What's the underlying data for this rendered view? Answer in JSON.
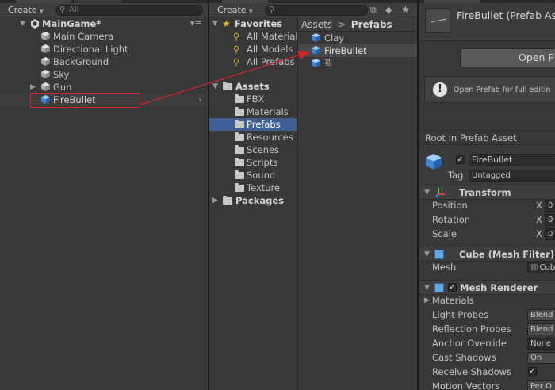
{
  "hierarchy": {
    "create_label": "Create",
    "search_placeholder": "All",
    "scene_name": "MainGame*",
    "items": [
      {
        "label": "Main Camera"
      },
      {
        "label": "Directional Light"
      },
      {
        "label": "BackGround"
      },
      {
        "label": "Sky"
      },
      {
        "label": "Gun"
      },
      {
        "label": "FireBullet"
      }
    ]
  },
  "project": {
    "create_label": "Create",
    "favorites": {
      "label": "Favorites",
      "items": [
        {
          "label": "All Material"
        },
        {
          "label": "All Models"
        },
        {
          "label": "All Prefabs"
        }
      ]
    },
    "assets": {
      "label": "Assets",
      "folders": [
        {
          "label": "FBX"
        },
        {
          "label": "Materials"
        },
        {
          "label": "Prefabs"
        },
        {
          "label": "Resources"
        },
        {
          "label": "Scenes"
        },
        {
          "label": "Scripts"
        },
        {
          "label": "Sound"
        },
        {
          "label": "Texture"
        }
      ]
    },
    "packages_label": "Packages",
    "breadcrumb": {
      "root": "Assets",
      "sep": ">",
      "current": "Prefabs"
    },
    "files": [
      {
        "label": "Clay"
      },
      {
        "label": "FireBullet"
      },
      {
        "label": "꾁"
      }
    ]
  },
  "inspector": {
    "prefab_title": "FireBullet (Prefab As",
    "open_prefab_label": "Open P",
    "info_text": "Open Prefab for full editin",
    "root_label": "Root in Prefab Asset",
    "object_name": "FireBullet",
    "tag_label": "Tag",
    "tag_value": "Untagged",
    "transform": {
      "title": "Transform",
      "props": [
        {
          "label": "Position"
        },
        {
          "label": "Rotation"
        },
        {
          "label": "Scale"
        }
      ],
      "axis": "X",
      "value": "0"
    },
    "mesh_filter": {
      "title": "Cube (Mesh Filter)",
      "mesh_label": "Mesh",
      "mesh_value": "Cub"
    },
    "mesh_renderer": {
      "title": "Mesh Renderer",
      "materials_label": "Materials",
      "props": [
        {
          "label": "Light Probes",
          "value": "Blend"
        },
        {
          "label": "Reflection Probes",
          "value": "Blend"
        },
        {
          "label": "Anchor Override",
          "value": "None"
        },
        {
          "label": "Cast Shadows",
          "value": "On"
        },
        {
          "label": "Receive Shadows",
          "value": "✓"
        },
        {
          "label": "Motion Vectors",
          "value": "Per O"
        }
      ]
    }
  },
  "colors": {
    "selection": "#3e5f96",
    "annotation": "#d8262b",
    "cube_blue": "#4a90d9"
  }
}
